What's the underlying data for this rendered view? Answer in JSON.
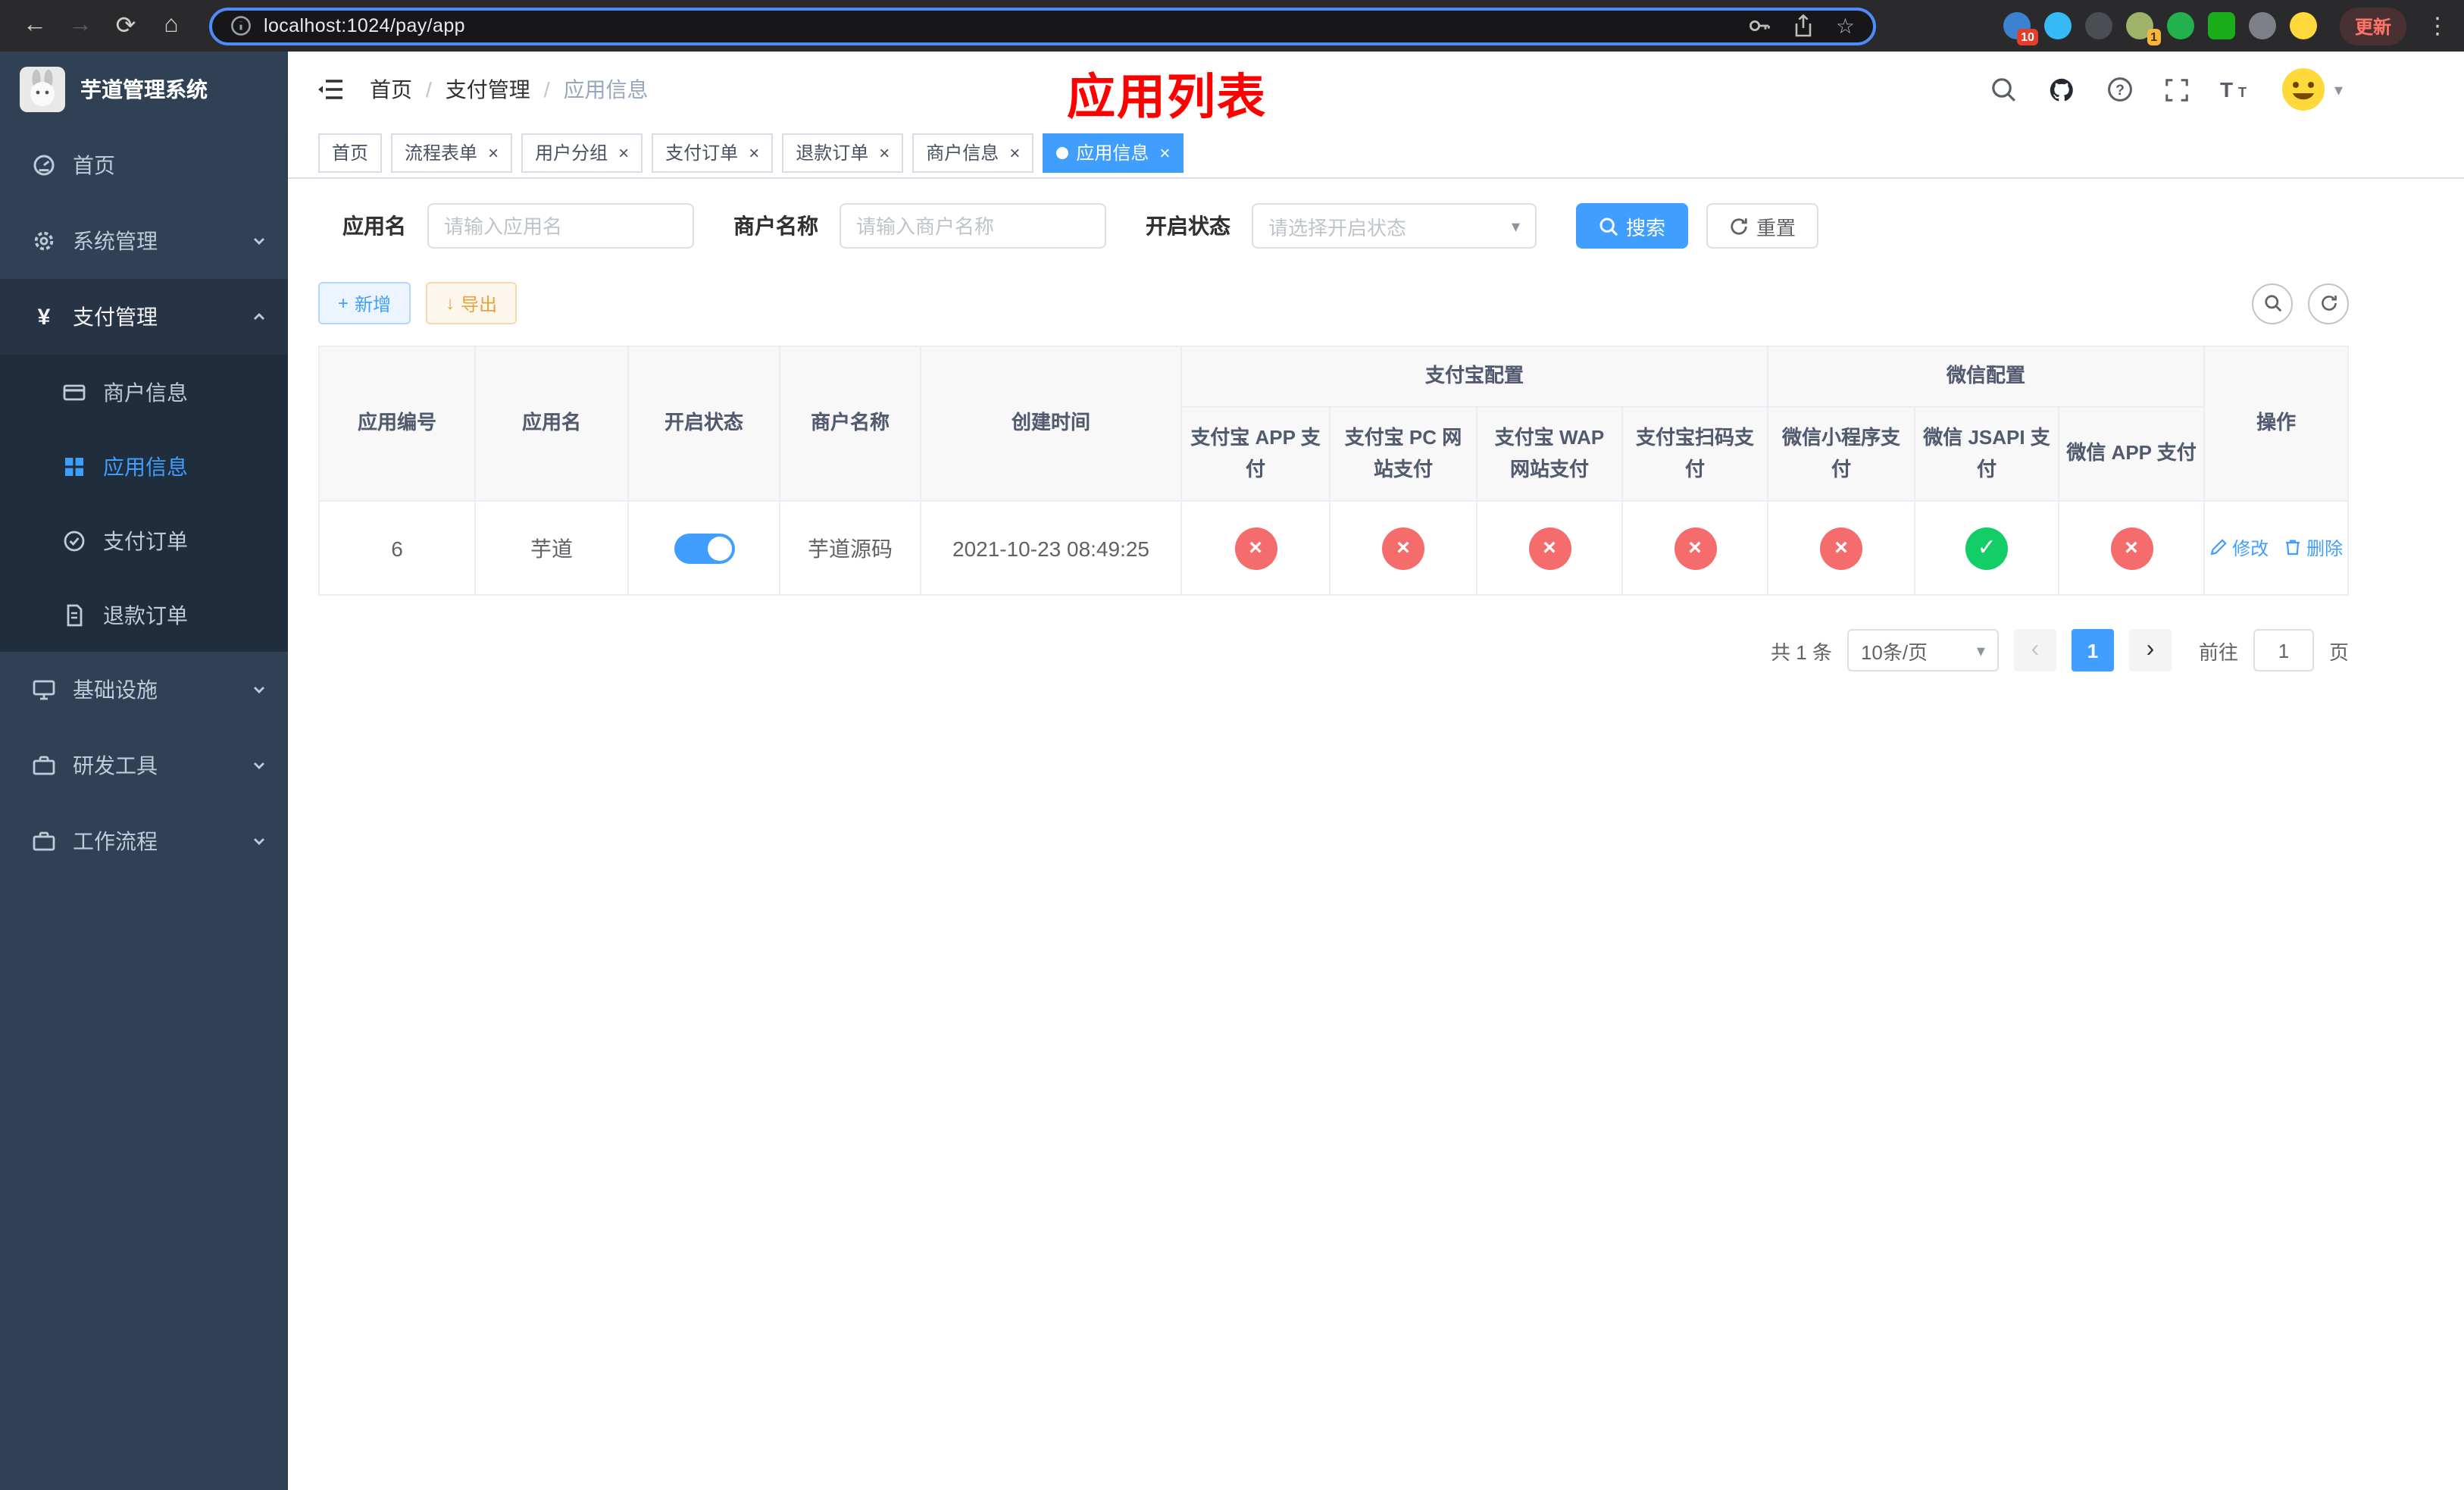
{
  "colors": {
    "primary": "#409eff",
    "success": "#13ce66",
    "danger": "#f56c6c",
    "warning": "#e6a23c",
    "overlay-red": "#ff0000",
    "sidebar-bg": "#304156",
    "sidebar-sub-bg": "#1f2d3d"
  },
  "icons": {
    "back": "←",
    "forward": "→",
    "reload": "⟳",
    "home": "⌂",
    "star": "☆",
    "menu_dots": "⋮",
    "check": "✓",
    "cross": "×",
    "close": "×",
    "prev": "‹",
    "next": "›",
    "caret": "▾",
    "plus": "+",
    "download": "↓",
    "yuan": "¥",
    "slash": "/"
  },
  "browser": {
    "url": "localhost:1024/pay/app",
    "update_button": "更新",
    "extension_badge_first": "10",
    "extension_badge_second": "1"
  },
  "sidebar": {
    "title": "芋道管理系统",
    "menu": [
      {
        "label": "首页"
      },
      {
        "label": "系统管理"
      },
      {
        "label": "支付管理"
      },
      {
        "label": "商户信息"
      },
      {
        "label": "应用信息"
      },
      {
        "label": "支付订单"
      },
      {
        "label": "退款订单"
      },
      {
        "label": "基础设施"
      },
      {
        "label": "研发工具"
      },
      {
        "label": "工作流程"
      }
    ]
  },
  "navbar": {
    "breadcrumb": [
      "首页",
      "支付管理",
      "应用信息"
    ]
  },
  "overlay_title": "应用列表",
  "tabs": [
    {
      "label": "首页"
    },
    {
      "label": "流程表单"
    },
    {
      "label": "用户分组"
    },
    {
      "label": "支付订单"
    },
    {
      "label": "退款订单"
    },
    {
      "label": "商户信息"
    },
    {
      "label": "应用信息"
    }
  ],
  "filter": {
    "app_name": {
      "label": "应用名",
      "placeholder": "请输入应用名"
    },
    "merchant": {
      "label": "商户名称",
      "placeholder": "请输入商户名称"
    },
    "status": {
      "label": "开启状态",
      "placeholder": "请选择开启状态"
    },
    "search": "搜索",
    "reset": "重置"
  },
  "toolbar": {
    "add": "新增",
    "export": "导出"
  },
  "table": {
    "headers": {
      "id": "应用编号",
      "name": "应用名",
      "status": "开启状态",
      "merchant": "商户名称",
      "created": "创建时间",
      "alipay_group": "支付宝配置",
      "wechat_group": "微信配置",
      "actions": "操作",
      "subs": [
        "支付宝 APP 支付",
        "支付宝 PC 网站支付",
        "支付宝 WAP 网站支付",
        "支付宝扫码支付",
        "微信小程序支付",
        "微信 JSAPI 支付",
        "微信 APP 支付"
      ]
    },
    "row": {
      "id": "6",
      "name": "芋道",
      "enabled": true,
      "merchant": "芋道源码",
      "created": "2021-10-23 08:49:25",
      "configs": [
        "cross",
        "cross",
        "cross",
        "cross",
        "cross",
        "check",
        "cross"
      ],
      "edit": "修改",
      "delete": "删除"
    }
  },
  "pagination": {
    "total": "共 1 条",
    "page_size": "10条/页",
    "page": "1",
    "goto": "前往",
    "goto_value": "1",
    "unit": "页"
  }
}
